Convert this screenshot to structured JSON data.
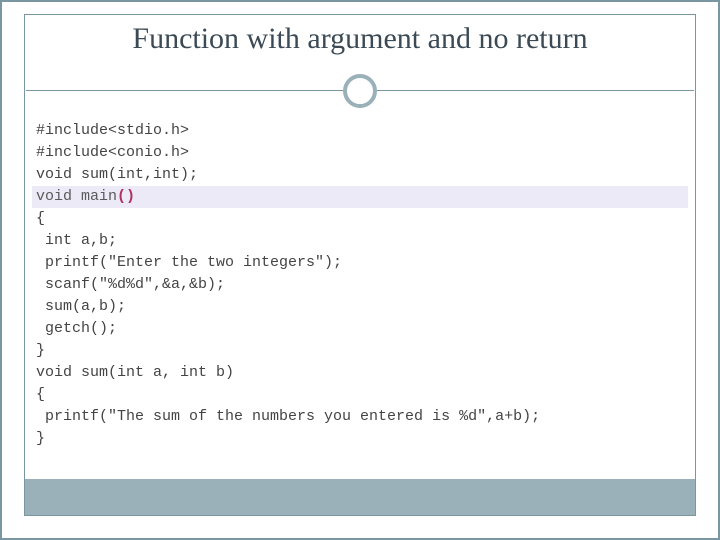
{
  "title": "Function with argument and no return",
  "code": {
    "l1": "#include<stdio.h>",
    "l2": "#include<conio.h>",
    "l3": "void sum(int,int);",
    "l4a": "void main",
    "l4b": "()",
    "l5": "{",
    "l6": " int a,b;",
    "l7": " printf(\"Enter the two integers\");",
    "l8": " scanf(\"%d%d\",&a,&b);",
    "l9": " sum(a,b);",
    "l10": " getch();",
    "l11": "}",
    "l12": "void sum(int a, int b)",
    "l13": "{",
    "l14": " printf(\"The sum of the numbers you entered is %d\",a+b);",
    "l15": "}"
  }
}
